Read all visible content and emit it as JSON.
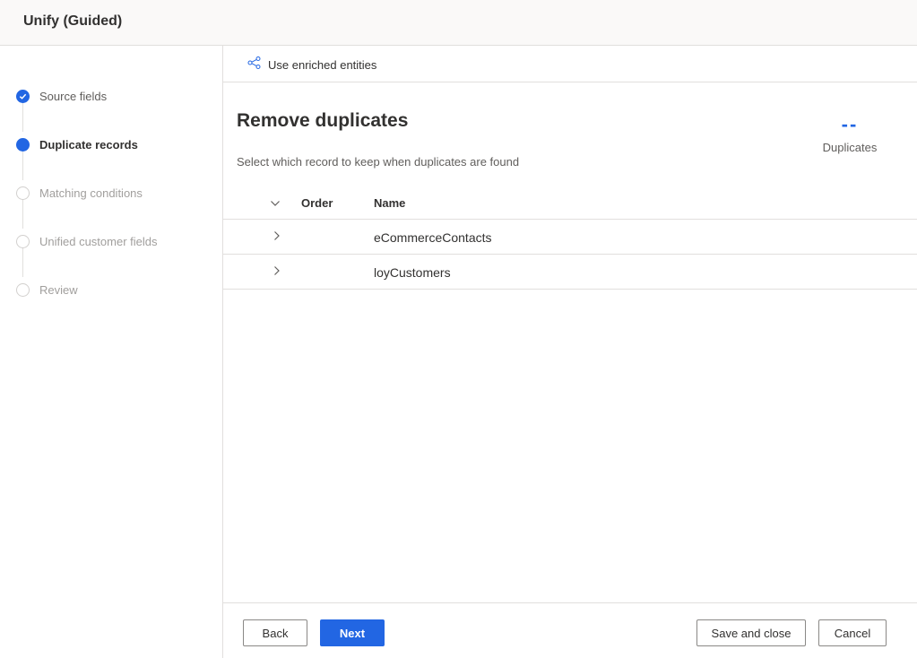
{
  "app": {
    "title": "Unify (Guided)"
  },
  "steps": [
    {
      "label": "Source fields",
      "state": "done"
    },
    {
      "label": "Duplicate records",
      "state": "active"
    },
    {
      "label": "Matching conditions",
      "state": "pending"
    },
    {
      "label": "Unified customer fields",
      "state": "pending"
    },
    {
      "label": "Review",
      "state": "pending"
    }
  ],
  "command_bar": {
    "enriched_label": "Use enriched entities",
    "icon": "share-nodes-icon"
  },
  "page": {
    "title": "Remove duplicates",
    "description": "Select which record to keep when duplicates are found"
  },
  "metric": {
    "value": "--",
    "label": "Duplicates"
  },
  "grid": {
    "columns": [
      "Order",
      "Name"
    ],
    "rows": [
      {
        "order": "",
        "name": "eCommerceContacts"
      },
      {
        "order": "",
        "name": "loyCustomers"
      }
    ]
  },
  "footer": {
    "back_label": "Back",
    "next_label": "Next",
    "save_close_label": "Save and close",
    "cancel_label": "Cancel"
  },
  "colors": {
    "accent": "#2266e3",
    "border": "#e1dfdd",
    "header_bg": "#faf9f8"
  }
}
